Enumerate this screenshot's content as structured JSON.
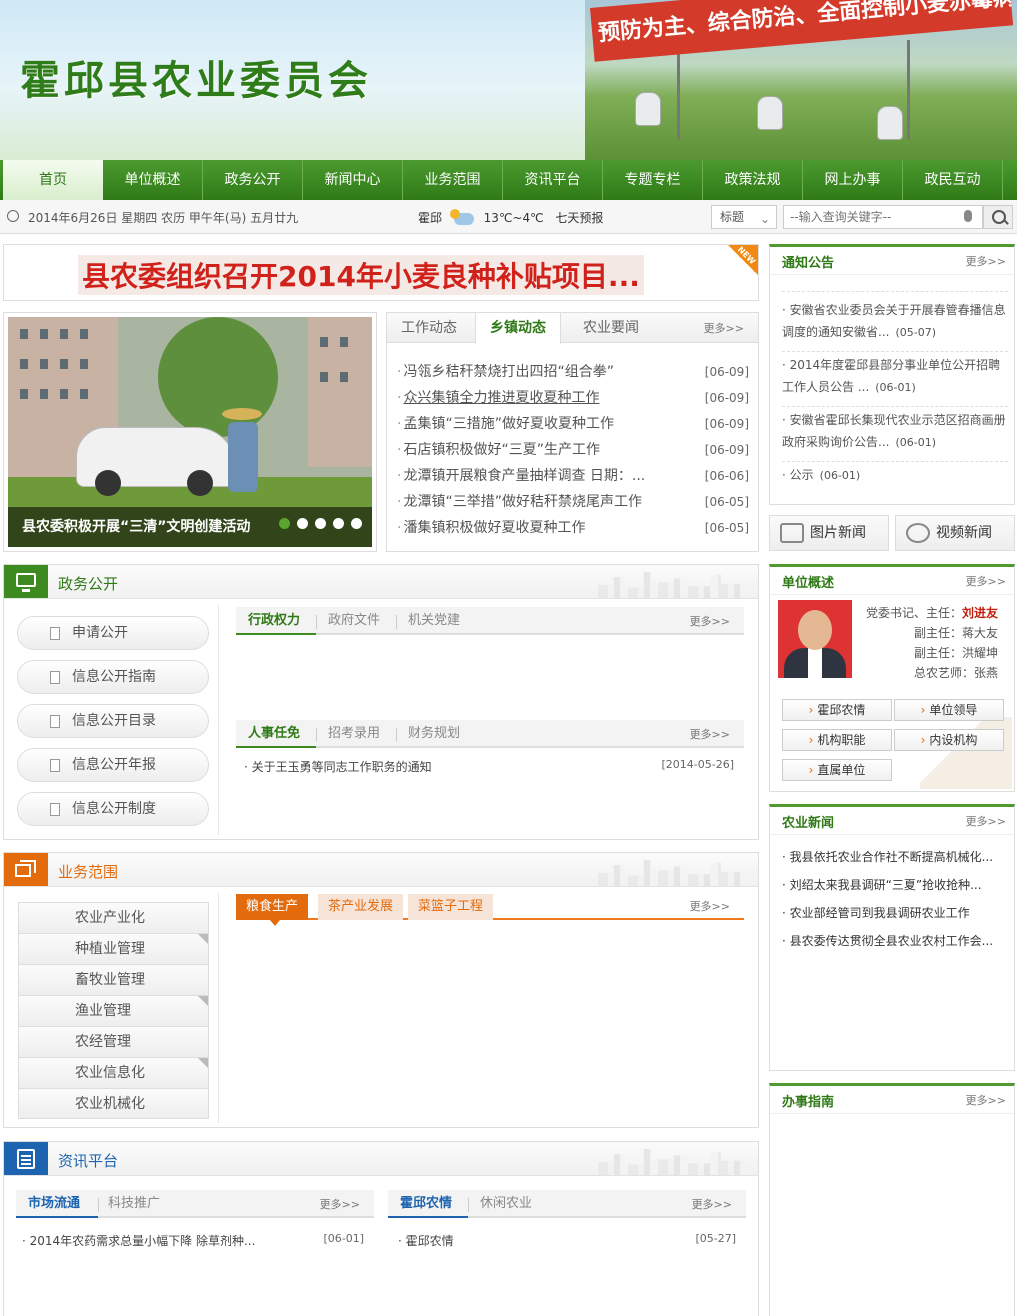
{
  "header": {
    "site_title": "霍邱县农业委员会",
    "slogan": "预防为主、综合防治、全面控制小麦赤霉病发生。"
  },
  "nav": [
    "首页",
    "单位概述",
    "政务公开",
    "新闻中心",
    "业务范围",
    "资讯平台",
    "专题专栏",
    "政策法规",
    "网上办事",
    "政民互动"
  ],
  "infobar": {
    "date": "2014年6月26日 星期四 农历 甲午年(马) 五月廿九",
    "city": "霍邱",
    "temp": "13℃~4℃",
    "forecast": "七天预报",
    "search_type": "标题",
    "search_placeholder": "--输入查询关键字--"
  },
  "headline": {
    "text": "县农委组织召开2014年小麦良种补贴项目...",
    "badge": "NEW"
  },
  "slideshow": {
    "caption": "县农委积极开展“三清”文明创建活动"
  },
  "news": {
    "tabs": [
      "工作动态",
      "乡镇动态",
      "农业要闻"
    ],
    "active_tab": "乡镇动态",
    "more": "更多>>",
    "items": [
      {
        "title": "冯瓴乡秸秆禁烧打出四招“组合拳”",
        "date": "[06-09]"
      },
      {
        "title": "众兴集镇全力推进夏收夏种工作",
        "date": "[06-09]"
      },
      {
        "title": "孟集镇“三措施”做好夏收夏种工作",
        "date": "[06-09]"
      },
      {
        "title": "石店镇积极做好“三夏”生产工作",
        "date": "[06-09]"
      },
      {
        "title": "龙潭镇开展粮食产量抽样调查 日期：...",
        "date": "[06-06]"
      },
      {
        "title": "龙潭镇“三举措”做好秸秆禁烧尾声工作",
        "date": "[06-05]"
      },
      {
        "title": "潘集镇积极做好夏收夏种工作",
        "date": "[06-05]"
      }
    ]
  },
  "zwgk": {
    "title": "政务公开",
    "buttons": [
      "申请公开",
      "信息公开指南",
      "信息公开目录",
      "信息公开年报",
      "信息公开制度"
    ],
    "tabs1": [
      "行政权力",
      "政府文件",
      "机关党建"
    ],
    "tabs2": [
      "人事任免",
      "招考录用",
      "财务规划"
    ],
    "more": "更多>>",
    "items": [
      {
        "title": "关于王玉勇等同志工作职务的通知",
        "date": "[2014-05-26]"
      }
    ]
  },
  "ywfw": {
    "title": "业务范围",
    "menu": [
      "农业产业化",
      "种植业管理",
      "畜牧业管理",
      "渔业管理",
      "农经管理",
      "农业信息化",
      "农业机械化"
    ],
    "tabs": [
      "粮食生产",
      "茶产业发展",
      "菜篮子工程"
    ],
    "more": "更多>>"
  },
  "zxpt": {
    "title": "资讯平台",
    "left_tabs": [
      "市场流通",
      "科技推广"
    ],
    "right_tabs": [
      "霍邱农情",
      "休闲农业"
    ],
    "more": "更多>>",
    "left_items": [
      {
        "title": "2014年农药需求总量小幅下降 除草剂种...",
        "date": "[06-01]"
      }
    ],
    "right_items": [
      {
        "title": "霍邱农情",
        "date": "[05-27]"
      }
    ]
  },
  "notice": {
    "title": "通知公告",
    "more": "更多>>",
    "items": [
      {
        "title": "安徽省农业委员会关于开展春管春播信息调度的通知安徽省...",
        "date": "(05-07)"
      },
      {
        "title": "2014年度霍邱县部分事业单位公开招聘工作人员公告 ...",
        "date": "(06-01)"
      },
      {
        "title": "安徽省霍邱长集现代农业示范区招商画册政府采购询价公告...",
        "date": "(06-01)"
      },
      {
        "title": "公示",
        "date": "(06-01)"
      }
    ]
  },
  "media": {
    "photo_news": "图片新闻",
    "video_news": "视频新闻"
  },
  "unit": {
    "title": "单位概述",
    "more": "更多>>",
    "leaders": [
      {
        "role": "党委书记、主任：",
        "name": "刘进友"
      },
      {
        "role": "副主任：",
        "name": "蒋大友"
      },
      {
        "role": "副主任：",
        "name": "洪耀坤"
      },
      {
        "role": "总农艺师：",
        "name": "张燕"
      }
    ],
    "links": [
      "霍邱农情",
      "单位领导",
      "机构职能",
      "内设机构",
      "直属单位"
    ]
  },
  "agnews": {
    "title": "农业新闻",
    "more": "更多>>",
    "items": [
      "我县依托农业合作社不断提高机械化...",
      "刘绍太来我县调研“三夏”抢收抢种...",
      "农业部经管司到我县调研农业工作",
      "县农委传达贯彻全县农业农村工作会..."
    ]
  },
  "guide": {
    "title": "办事指南",
    "more": "更多>>"
  },
  "colors": {
    "brand_green": "#2f7a17",
    "headline_red": "#d0221a",
    "accent_orange": "#e46b0c",
    "info_blue": "#1d64b0"
  }
}
